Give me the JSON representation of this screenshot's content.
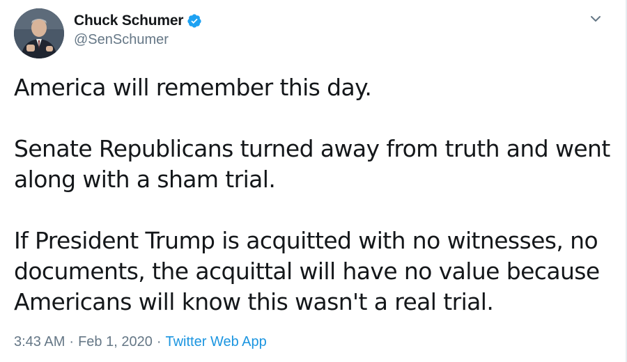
{
  "author": {
    "display_name": "Chuck Schumer",
    "handle": "@SenSchumer",
    "avatar_icon": "user-avatar-icon",
    "verified_icon": "verified-badge-icon"
  },
  "tweet": {
    "paragraphs": [
      "America will remember this day.",
      "Senate Republicans turned away from truth and went\nalong with a sham trial.",
      "If President Trump is acquitted with no witnesses, no\ndocuments, the acquittal will have no value because\nAmericans will know this wasn't a real trial."
    ]
  },
  "meta": {
    "time": "3:43 AM",
    "separator": "·",
    "date": "Feb 1, 2020",
    "source": "Twitter Web App"
  },
  "colors": {
    "text": "#14171a",
    "secondary": "#657786",
    "link": "#1b95e0",
    "verified": "#1da1f2"
  },
  "menu": {
    "caret_icon": "chevron-down-icon"
  }
}
